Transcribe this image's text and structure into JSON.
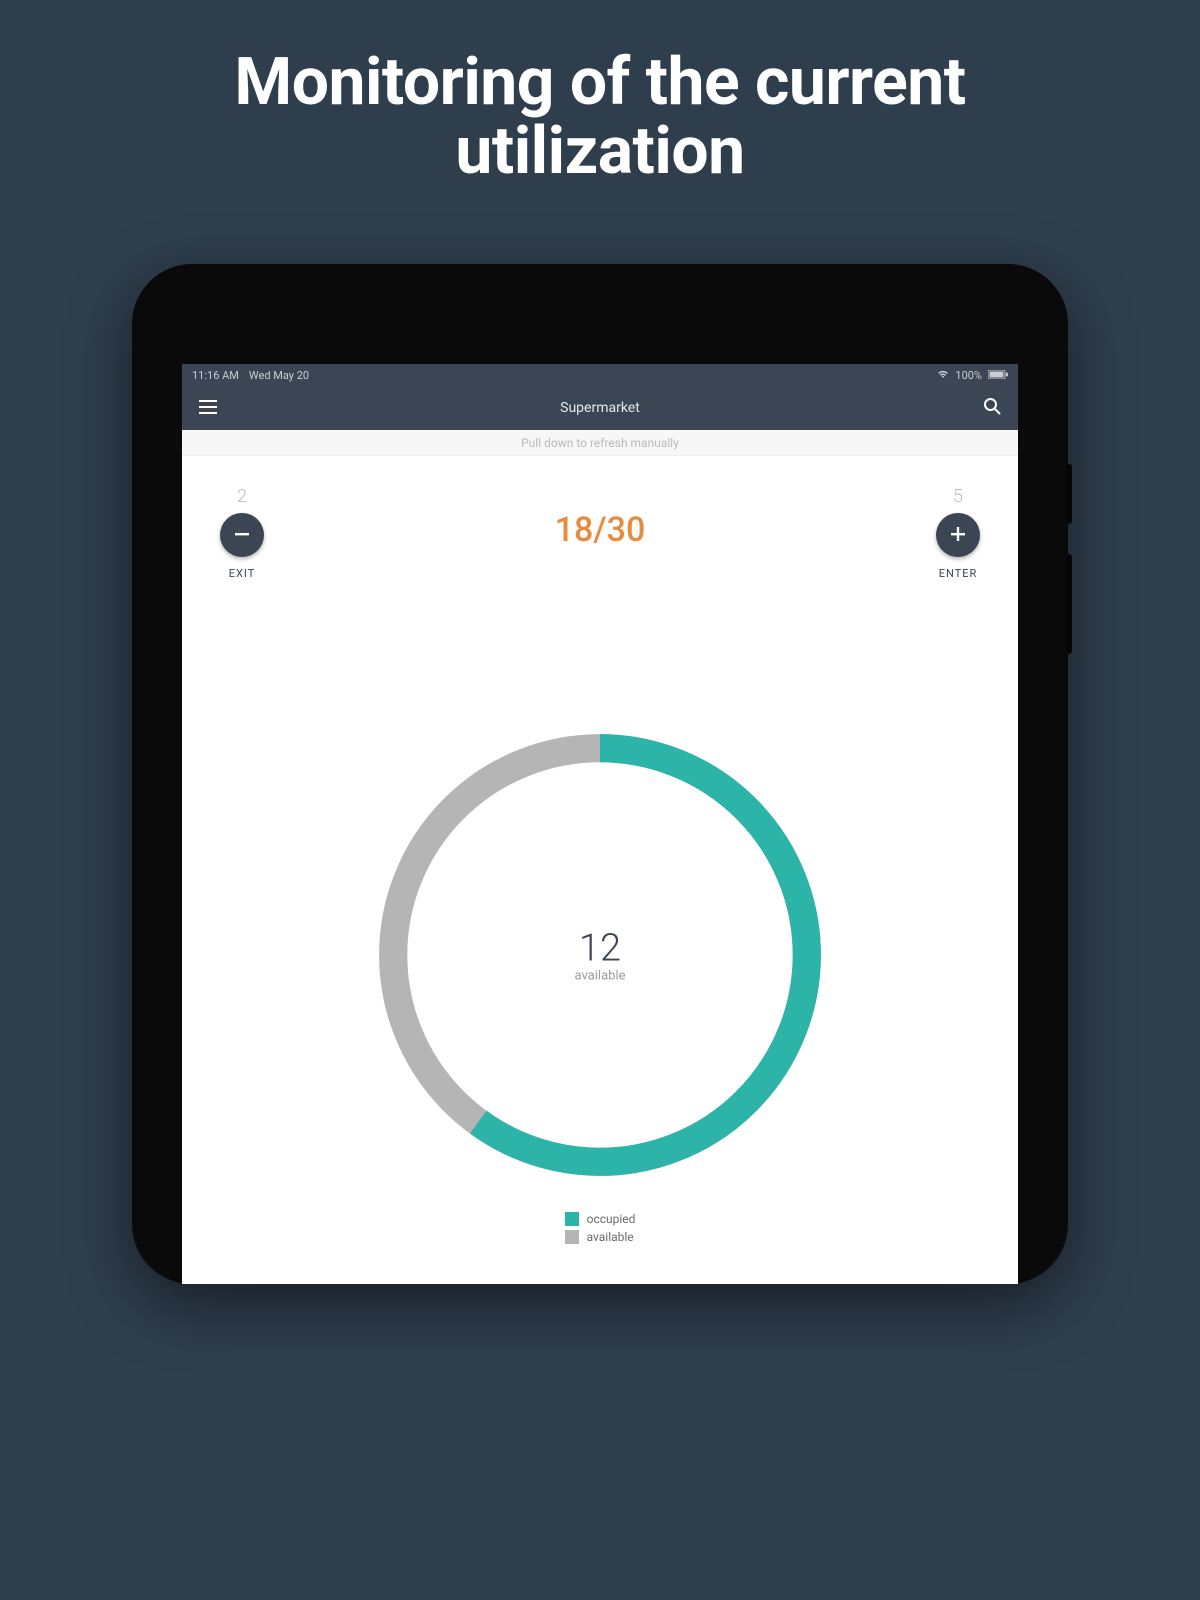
{
  "promo": {
    "title_line1": "Monitoring of the current",
    "title_line2": "utilization"
  },
  "status": {
    "time": "11:16 AM",
    "date": "Wed May 20",
    "battery_pct": "100%"
  },
  "appbar": {
    "title": "Supermarket"
  },
  "hint": {
    "text": "Pull down to refresh manually"
  },
  "counter": {
    "exit_pending": "2",
    "enter_pending": "5",
    "exit_label": "EXIT",
    "enter_label": "ENTER",
    "ratio": "18/30"
  },
  "chart_data": {
    "type": "pie",
    "title": "",
    "center_value": "12",
    "center_label": "available",
    "series": [
      {
        "name": "occupied",
        "value": 18,
        "color": "#2db4a8"
      },
      {
        "name": "available",
        "value": 12,
        "color": "#b5b5b5"
      }
    ],
    "total": 30
  },
  "legend": {
    "items": [
      {
        "label": "occupied",
        "color": "#2db4a8"
      },
      {
        "label": "available",
        "color": "#b5b5b5"
      }
    ]
  },
  "colors": {
    "accent": "#e78b3e",
    "bar": "#3b4553",
    "bg": "#2f3e4d"
  }
}
